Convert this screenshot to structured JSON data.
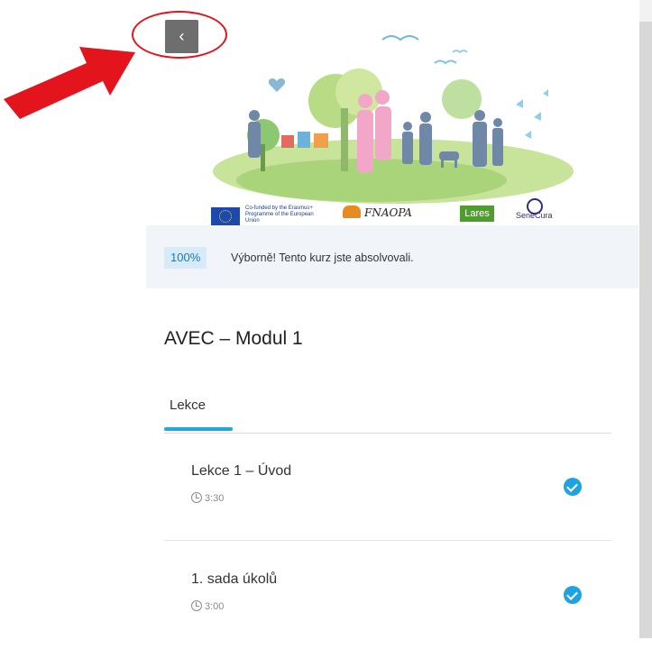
{
  "back_button": {
    "label": "‹",
    "icon": "chevron-left-icon"
  },
  "hero": {
    "eu_label": "Co-funded by the Erasmus+ Programme of the European Union",
    "partner_fnaopa": "FNAOPA",
    "partner_lares": "Lares",
    "partner_senecura": "SeneCura"
  },
  "progress": {
    "percent_label": "100%",
    "message": "Výborně! Tento kurz jste absolvovali."
  },
  "course": {
    "title": "AVEC – Modul 1"
  },
  "tabs": [
    {
      "label": "Lekce",
      "active": true
    }
  ],
  "lessons": [
    {
      "title": "Lekce 1 – Úvod",
      "duration": "3:30",
      "completed": true
    },
    {
      "title": "1. sada úkolů",
      "duration": "3:00",
      "completed": true
    }
  ],
  "colors": {
    "accent": "#1fa7df",
    "annotation": "#e3141b",
    "banner_bg": "#f1f5f9",
    "badge_bg": "#d6ebf7"
  }
}
